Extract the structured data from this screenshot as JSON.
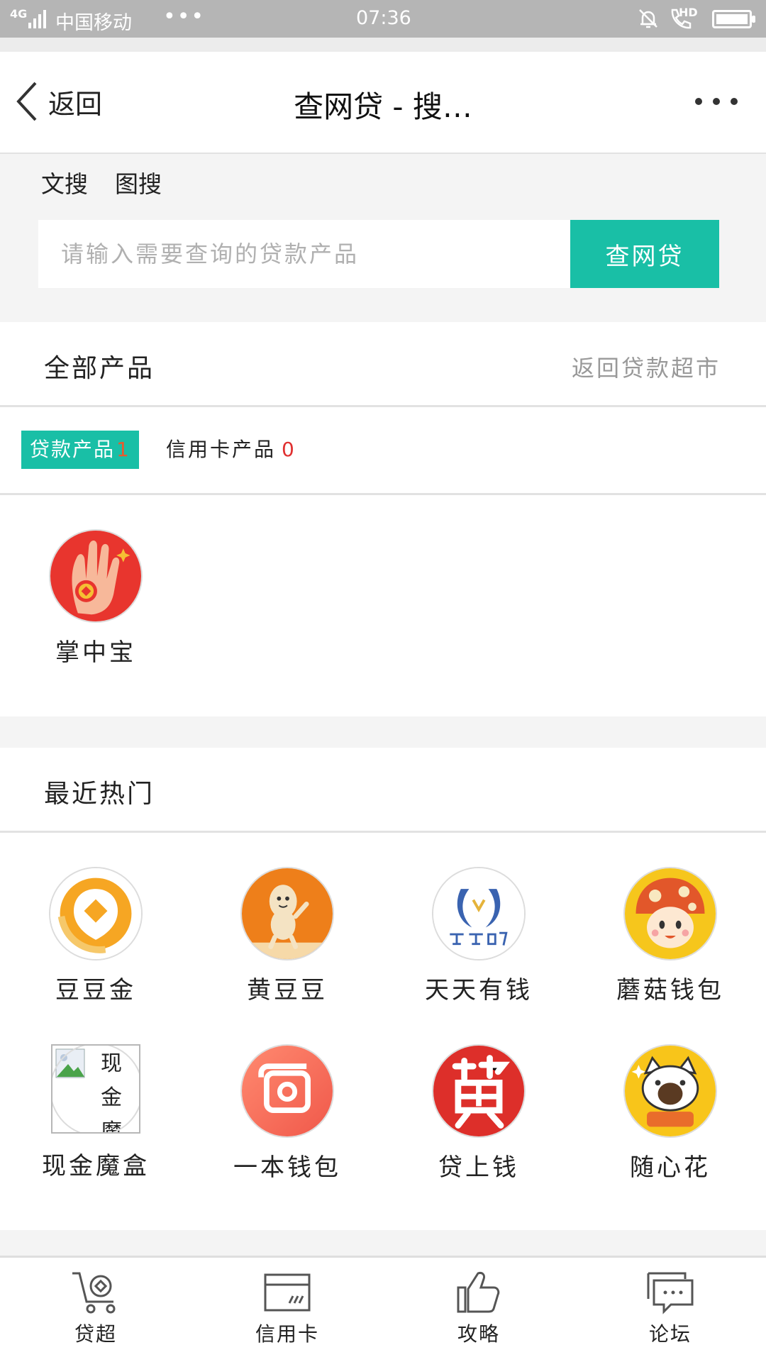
{
  "status_bar": {
    "network": "4G",
    "carrier": "中国移动",
    "more": "•••",
    "time": "07:36",
    "hd": "HD"
  },
  "header": {
    "back_label": "返回",
    "title": "查网贷 - 搜…",
    "more_icon": "more-dots-icon"
  },
  "search": {
    "tabs": [
      "文搜",
      "图搜"
    ],
    "placeholder": "请输入需要查询的贷款产品",
    "button": "查网贷"
  },
  "all_products": {
    "title": "全部产品",
    "link": "返回贷款超市"
  },
  "product_tabs": {
    "loan_label": "贷款产品",
    "loan_count": "1",
    "card_label": "信用卡产品",
    "card_count": "0"
  },
  "results": [
    {
      "name": "掌中宝",
      "icon": "hand-coin-icon"
    }
  ],
  "hot": {
    "title": "最近热门",
    "items": [
      {
        "name": "豆豆金",
        "icon": "doudoujin-logo-icon"
      },
      {
        "name": "黄豆豆",
        "icon": "peanut-mascot-icon"
      },
      {
        "name": "天天有钱",
        "icon": "tiantian-logo-icon"
      },
      {
        "name": "蘑菇钱包",
        "icon": "mushroom-mascot-icon"
      },
      {
        "name": "现金魔盒",
        "icon": "broken-image-icon",
        "alt": "现金魔"
      },
      {
        "name": "一本钱包",
        "icon": "wallet-logo-icon"
      },
      {
        "name": "贷上钱",
        "icon": "dai-character-icon"
      },
      {
        "name": "随心花",
        "icon": "cat-mascot-icon"
      }
    ]
  },
  "tabbar": [
    {
      "label": "贷超",
      "icon": "cart-icon"
    },
    {
      "label": "信用卡",
      "icon": "credit-card-icon"
    },
    {
      "label": "攻略",
      "icon": "thumbs-up-icon"
    },
    {
      "label": "论坛",
      "icon": "chat-bubble-icon"
    }
  ]
}
